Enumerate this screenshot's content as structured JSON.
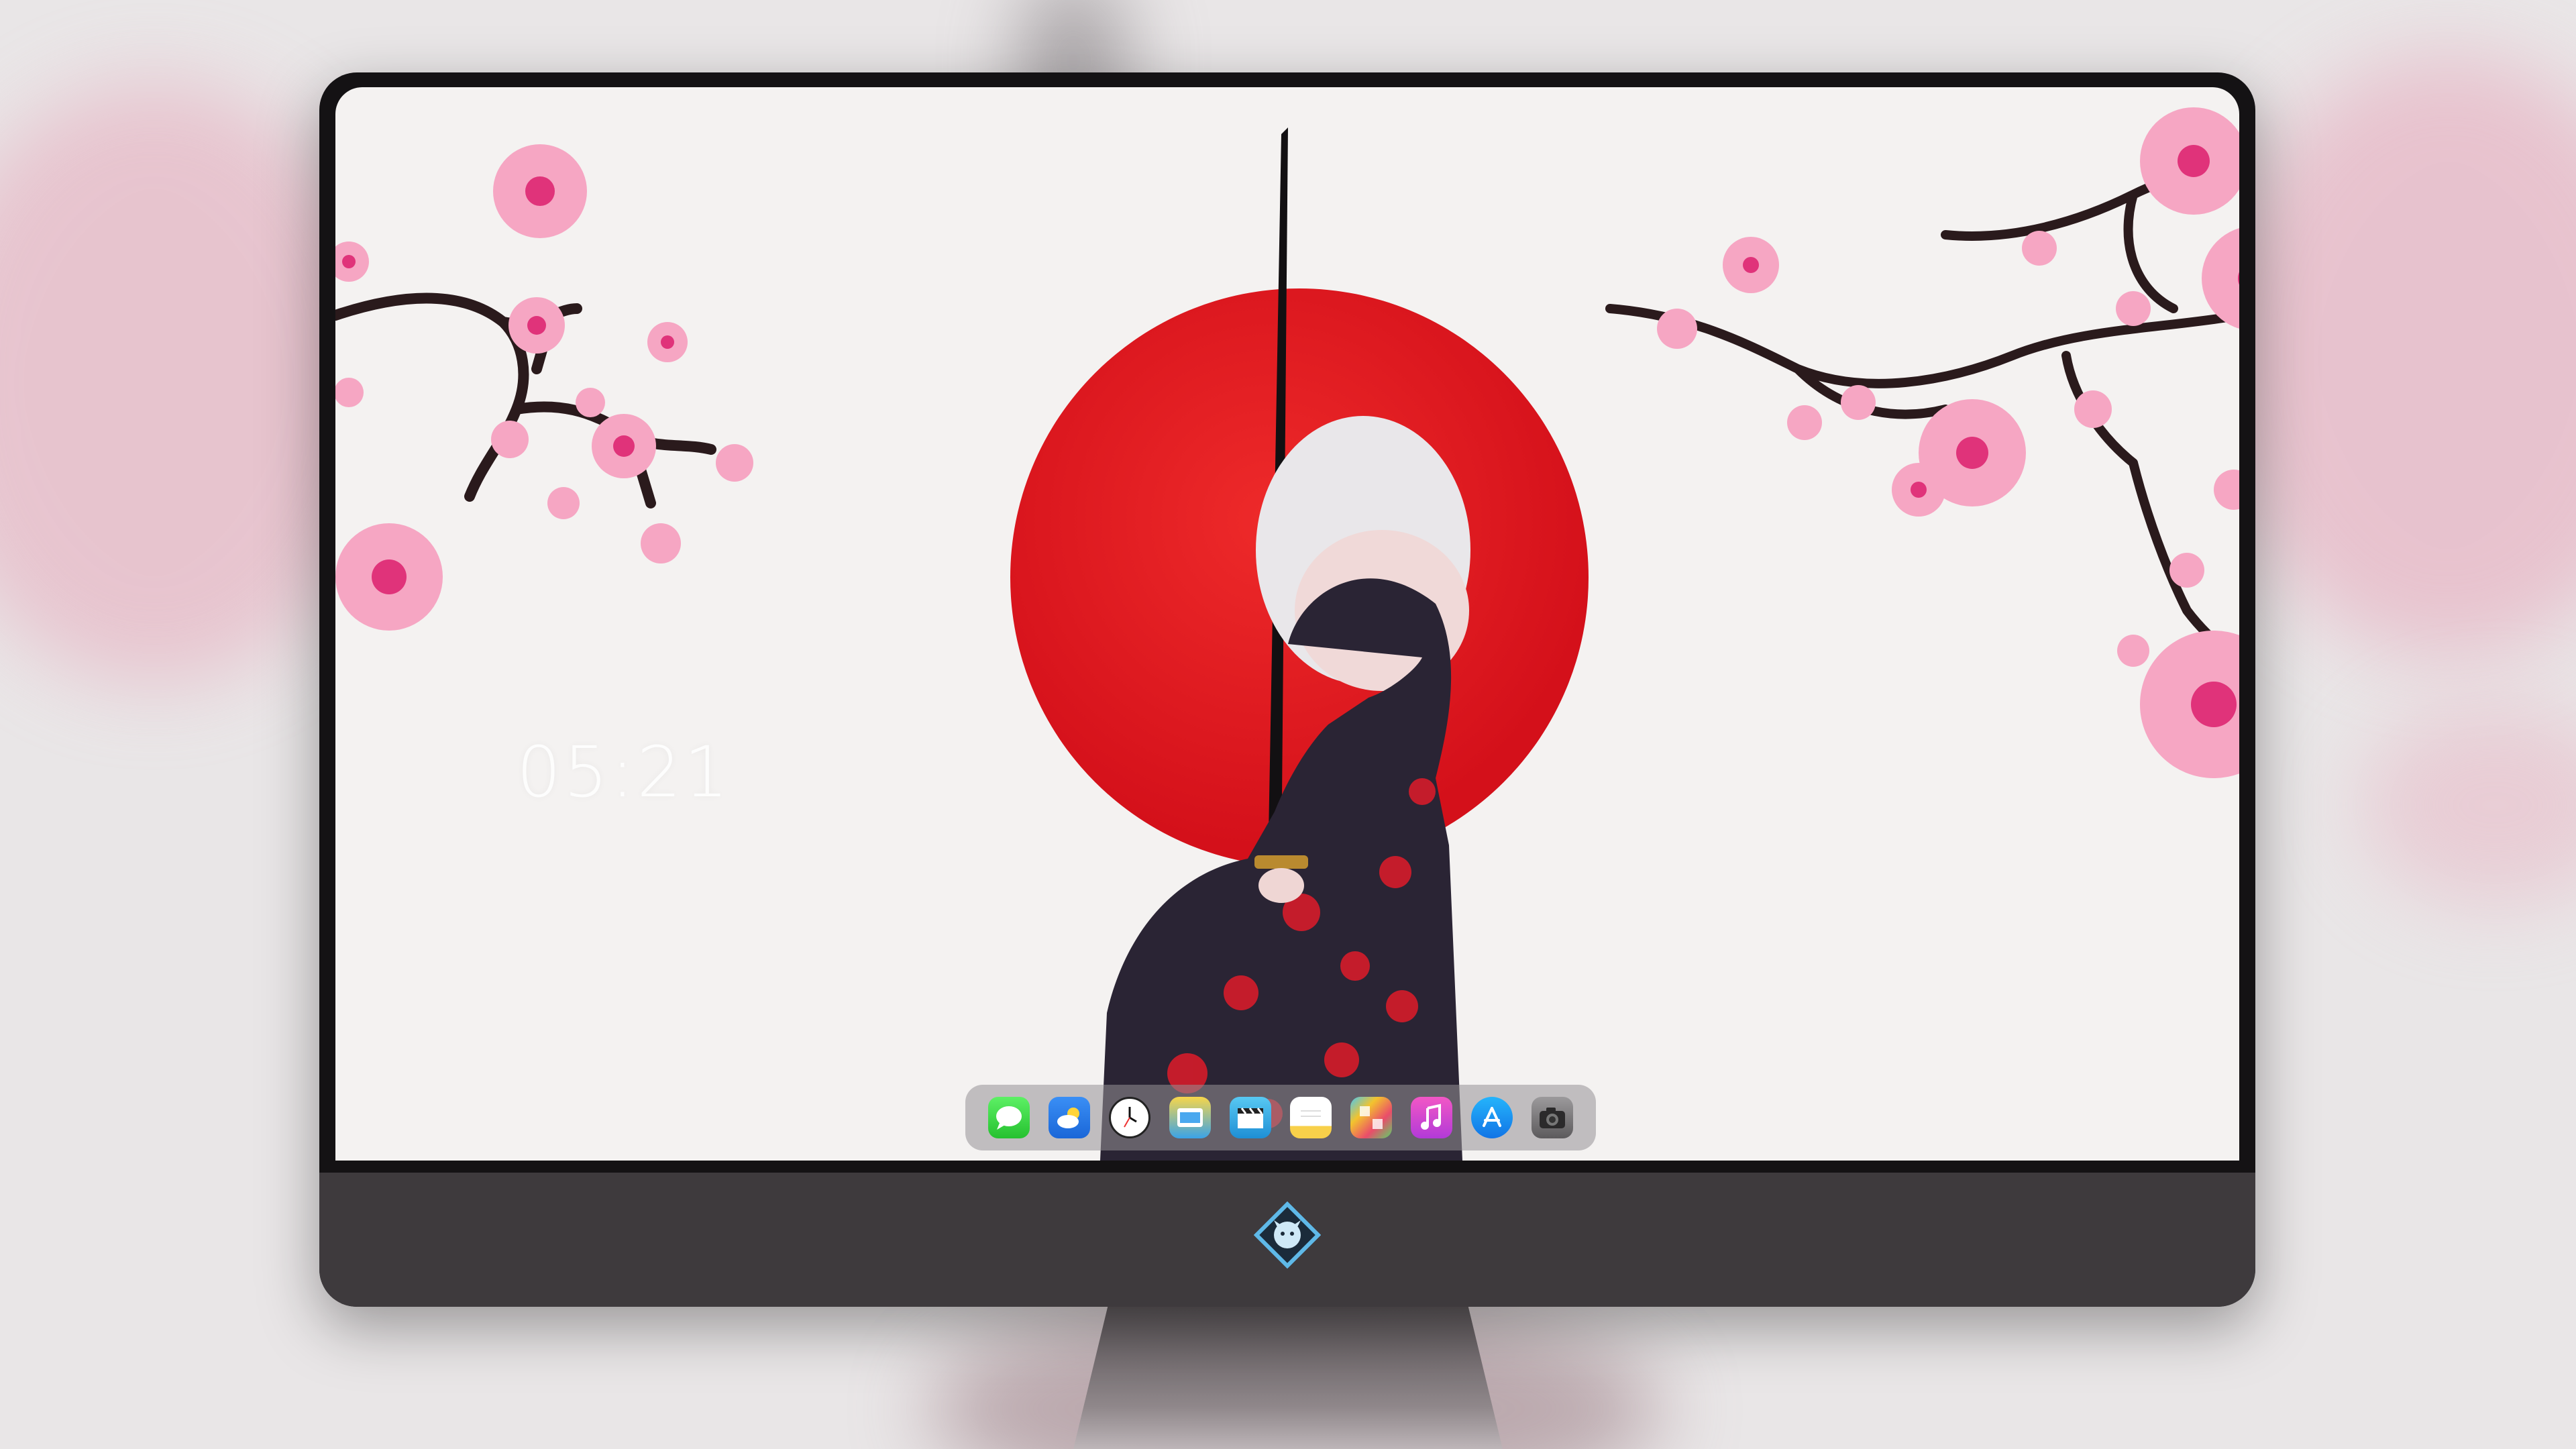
{
  "desktop": {
    "clock_time": "05:21"
  },
  "dock": {
    "items": [
      {
        "name": "messages",
        "icon": "message-bubble-icon",
        "color": "#34c759"
      },
      {
        "name": "weather",
        "icon": "cloud-sun-icon",
        "color": "#1a66d8"
      },
      {
        "name": "clock",
        "icon": "clock-icon",
        "color": "#ffffff"
      },
      {
        "name": "finder",
        "icon": "folder-window-icon",
        "color": "#3aa3e8"
      },
      {
        "name": "video",
        "icon": "clapperboard-icon",
        "color": "#1e8fd5"
      },
      {
        "name": "notes",
        "icon": "notepad-icon",
        "color": "#f8d04a"
      },
      {
        "name": "photos",
        "icon": "photo-grid-icon",
        "color": "#5ad368"
      },
      {
        "name": "music",
        "icon": "music-note-icon",
        "color": "#e04fd0"
      },
      {
        "name": "app-store",
        "icon": "app-store-icon",
        "color": "#1174e6"
      },
      {
        "name": "camera",
        "icon": "camera-icon",
        "color": "#6e6c6e"
      }
    ]
  },
  "colors": {
    "sun_red": "#d4101a",
    "blossom_pink": "#f48fb1",
    "branch_dark": "#2a1a1c",
    "monitor_bezel": "#141214",
    "monitor_chin": "#3e3a3d"
  }
}
